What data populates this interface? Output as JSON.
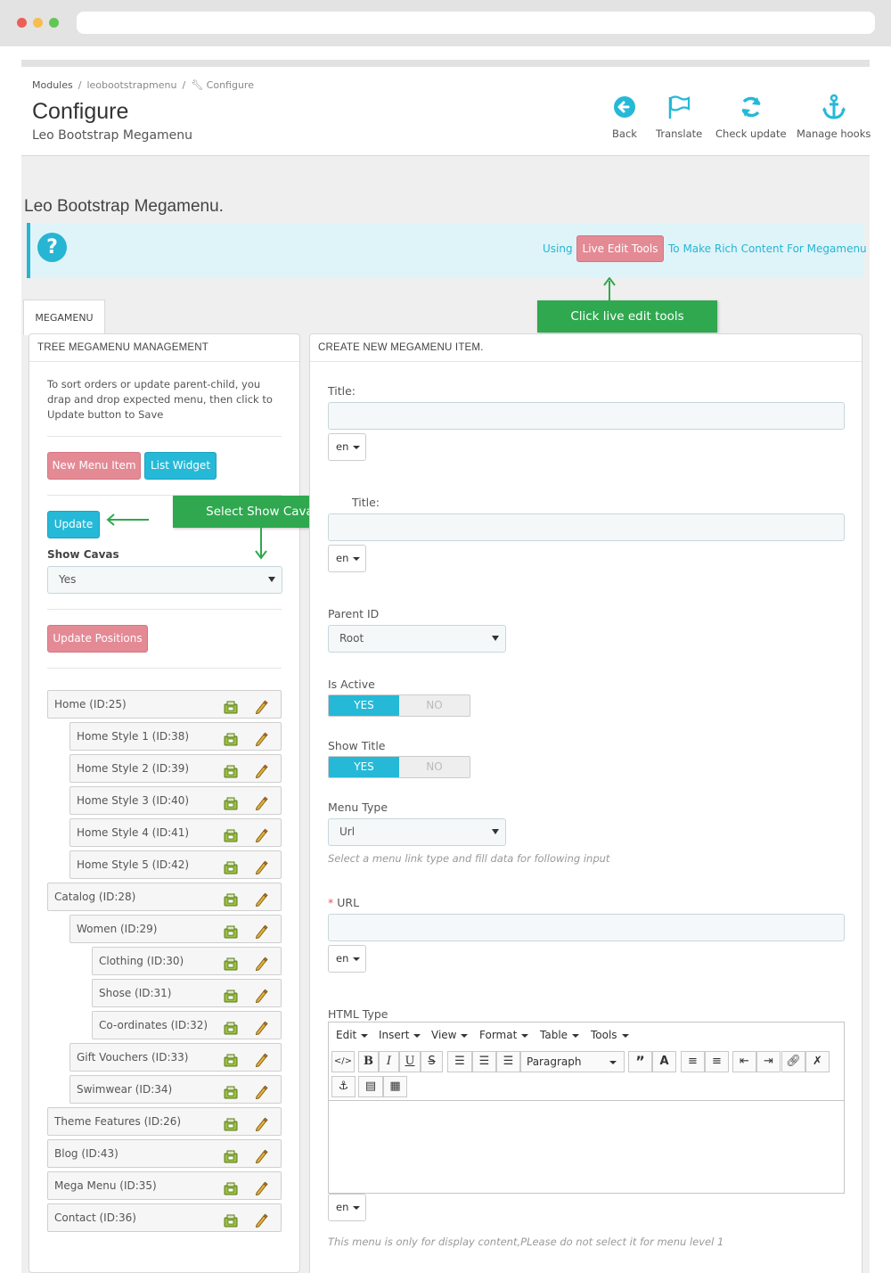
{
  "breadcrumb": {
    "modules": "Modules",
    "module": "leobootstrapmenu",
    "current": "Configure"
  },
  "header": {
    "title": "Configure",
    "subtitle": "Leo Bootstrap Megamenu"
  },
  "toolbar": {
    "back": "Back",
    "translate": "Translate",
    "check_update": "Check update",
    "manage_hooks": "Manage hooks"
  },
  "module_title": "Leo Bootstrap Megamenu.",
  "info": {
    "using": "Using",
    "live_edit_button": "Live Edit Tools",
    "rest": "To Make Rich Content For Megamenu"
  },
  "callouts": {
    "live_edit": "Click live edit tools",
    "show_cavas": "Select Show Cavas"
  },
  "tab": "MEGAMENU",
  "tree_panel": {
    "heading": "TREE MEGAMENU MANAGEMENT",
    "description": "To sort orders or update parent-child, you drap and drop expected menu, then click to Update button to Save",
    "new_menu_item": "New Menu Item",
    "list_widget": "List Widget",
    "update": "Update",
    "show_cavas_label": "Show Cavas",
    "show_cavas_value": "Yes",
    "update_positions": "Update Positions",
    "items": [
      "Home (ID:25)",
      "Home Style 1 (ID:38)",
      "Home Style 2 (ID:39)",
      "Home Style 3 (ID:40)",
      "Home Style 4 (ID:41)",
      "Home Style 5 (ID:42)",
      "Catalog (ID:28)",
      "Women (ID:29)",
      "Clothing (ID:30)",
      "Shose (ID:31)",
      "Co-ordinates (ID:32)",
      "Gift Vouchers (ID:33)",
      "Swimwear (ID:34)",
      "Theme Features (ID:26)",
      "Blog (ID:43)",
      "Mega Menu (ID:35)",
      "Contact (ID:36)"
    ]
  },
  "form_panel": {
    "heading": "CREATE NEW MEGAMENU ITEM.",
    "title_label": "Title:",
    "subtitle_label": "Title:",
    "lang": "en",
    "parent_id_label": "Parent ID",
    "parent_id_value": "Root",
    "is_active_label": "Is Active",
    "show_title_label": "Show Title",
    "yes": "YES",
    "no": "NO",
    "menu_type_label": "Menu Type",
    "menu_type_value": "Url",
    "menu_type_help": "Select a menu link type and fill data for following input",
    "required_mark": "*",
    "url_label": "URL",
    "html_type_label": "HTML Type",
    "editor_menus": [
      "Edit",
      "Insert",
      "View",
      "Format",
      "Table",
      "Tools"
    ],
    "paragraph": "Paragraph",
    "bottom_help": "This menu is only for display content,PLease do not select it for menu level 1"
  },
  "colors": {
    "accent_blue": "#25b9d7",
    "pink_button": "#e48a95",
    "callout_green": "#2fa84f",
    "info_bg": "#dff4f9"
  }
}
